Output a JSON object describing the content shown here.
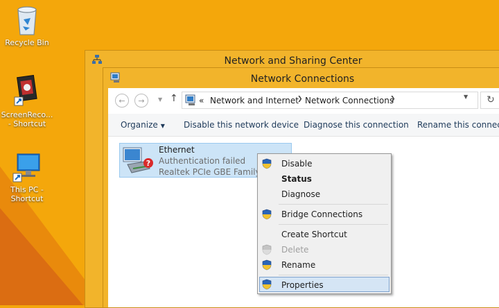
{
  "desktop": {
    "icons": [
      {
        "label": "Recycle Bin"
      },
      {
        "label_line1": "ScreenReco...",
        "label_line2": "- Shortcut"
      },
      {
        "label_line1": "This PC -",
        "label_line2": "Shortcut"
      }
    ]
  },
  "back_window": {
    "title": "Network and Sharing Center"
  },
  "window": {
    "title": "Network Connections"
  },
  "address_bar": {
    "overflow": "«",
    "crumbs": [
      "Network and Internet",
      "Network Connections"
    ]
  },
  "toolbar": {
    "organize": "Organize",
    "disable": "Disable this network device",
    "diagnose": "Diagnose this connection",
    "rename": "Rename this connection"
  },
  "connection": {
    "name": "Ethernet",
    "status": "Authentication failed",
    "adapter": "Realtek PCIe GBE Family Controller"
  },
  "context_menu": {
    "items": [
      {
        "label": "Disable",
        "shield": true
      },
      {
        "label": "Status",
        "bold": true
      },
      {
        "label": "Diagnose"
      },
      {
        "label": "Bridge Connections",
        "shield": true
      },
      {
        "label": "Create Shortcut"
      },
      {
        "label": "Delete",
        "shield": true,
        "disabled": true
      },
      {
        "label": "Rename",
        "shield": true
      },
      {
        "label": "Properties",
        "shield": true,
        "highlighted": true
      }
    ]
  },
  "colors": {
    "desktop": "#f4a70b",
    "title_bar": "#f2b42b",
    "selection": "#cce4f7",
    "menu_highlight": "#d5e5f5"
  }
}
